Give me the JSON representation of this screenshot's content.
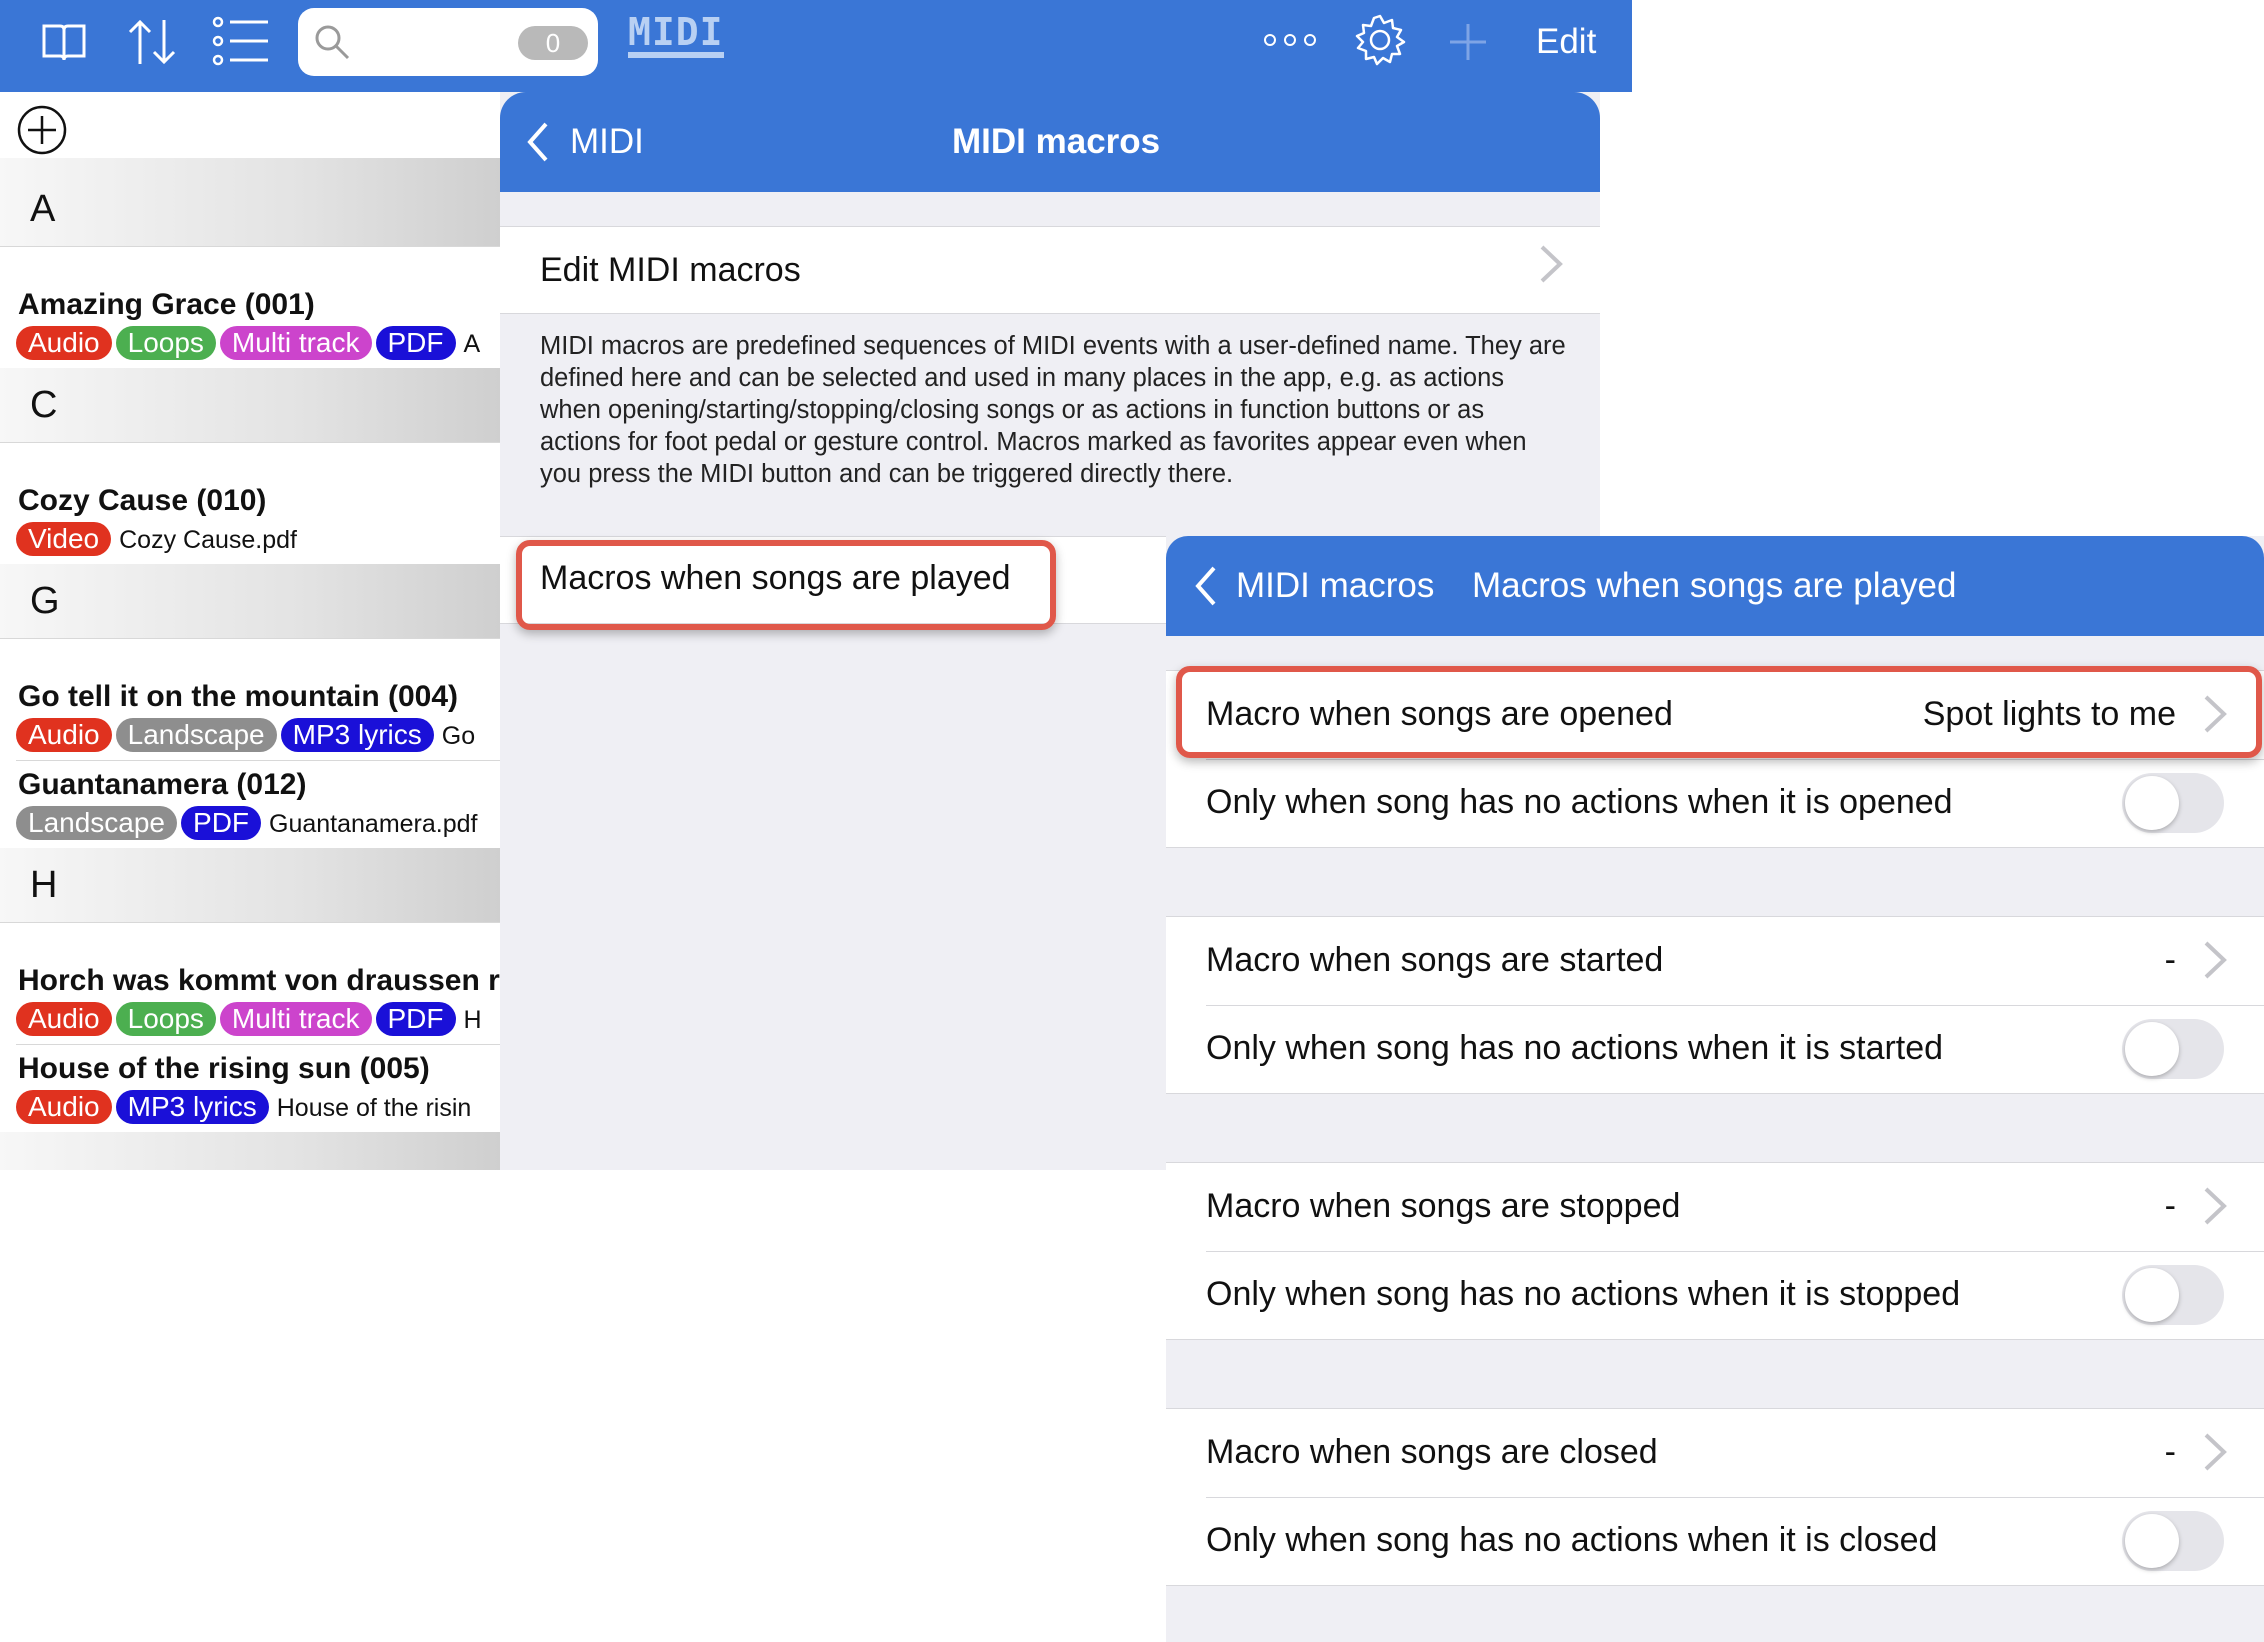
{
  "toolbar": {
    "search_count": "0",
    "midi_logo": "MIDI",
    "edit_label": "Edit",
    "icons": [
      "book-icon",
      "sort-icon",
      "list-icon",
      "search-icon",
      "more-icon",
      "gear-icon",
      "plus-icon"
    ]
  },
  "song_list": {
    "sections": [
      {
        "letter": "A",
        "songs": [
          {
            "title": "Amazing Grace (001)",
            "tags": [
              "Audio",
              "Loops",
              "Multi track",
              "PDF"
            ],
            "file": "A"
          }
        ]
      },
      {
        "letter": "C",
        "songs": [
          {
            "title": "Cozy Cause (010)",
            "tags": [
              "Video"
            ],
            "file": "Cozy Cause.pdf"
          }
        ]
      },
      {
        "letter": "G",
        "songs": [
          {
            "title": "Go tell it on the mountain (004)",
            "tags": [
              "Audio",
              "Landscape",
              "MP3 lyrics"
            ],
            "file": "Go"
          },
          {
            "title": "Guantanamera (012)",
            "tags": [
              "Landscape",
              "PDF"
            ],
            "file": "Guantanamera.pdf"
          }
        ]
      },
      {
        "letter": "H",
        "songs": [
          {
            "title": "Horch was kommt von draussen re",
            "tags": [
              "Audio",
              "Loops",
              "Multi track",
              "PDF"
            ],
            "file": "H"
          },
          {
            "title": "House of the rising sun (005)",
            "tags": [
              "Audio",
              "MP3 lyrics"
            ],
            "file": "House of the risin"
          }
        ]
      }
    ],
    "tag_colors": {
      "Audio": "#e0321f",
      "Loops": "#4caf50",
      "Multi track": "#cc44cc",
      "PDF": "#1a10d8",
      "Video": "#e0321f",
      "Landscape": "#8e8e8e",
      "MP3 lyrics": "#1a10d8"
    }
  },
  "midi_macros_panel": {
    "back_label": "MIDI",
    "title": "MIDI macros",
    "edit_row_label": "Edit MIDI macros",
    "description": "MIDI macros are predefined sequences of MIDI events with a user-defined name. They are defined here and can be selected and used in many places in the app, e.g. as actions when opening/starting/stopping/closing songs or as actions in function buttons or as actions for foot pedal or gesture control. Macros marked as favorites appear even when you press the MIDI button and can be triggered directly there.",
    "played_row_label": "Macros when songs are played"
  },
  "songs_played_panel": {
    "back_label": "MIDI macros",
    "title": "Macros when songs are played",
    "groups": [
      {
        "macro_label": "Macro when songs are opened",
        "macro_value": "Spot lights to me",
        "only_label": "Only when song has no actions when it is opened",
        "only_on": false
      },
      {
        "macro_label": "Macro when songs are started",
        "macro_value": "-",
        "only_label": "Only when song has no actions when it is started",
        "only_on": false
      },
      {
        "macro_label": "Macro when songs are stopped",
        "macro_value": "-",
        "only_label": "Only when song has no actions when it is stopped",
        "only_on": false
      },
      {
        "macro_label": "Macro when songs are closed",
        "macro_value": "-",
        "only_label": "Only when song has no actions when it is closed",
        "only_on": false
      }
    ]
  },
  "colors": {
    "nav_blue": "#3a76d6",
    "highlight_red": "#e0584a",
    "grouped_background": "#efeff4"
  }
}
